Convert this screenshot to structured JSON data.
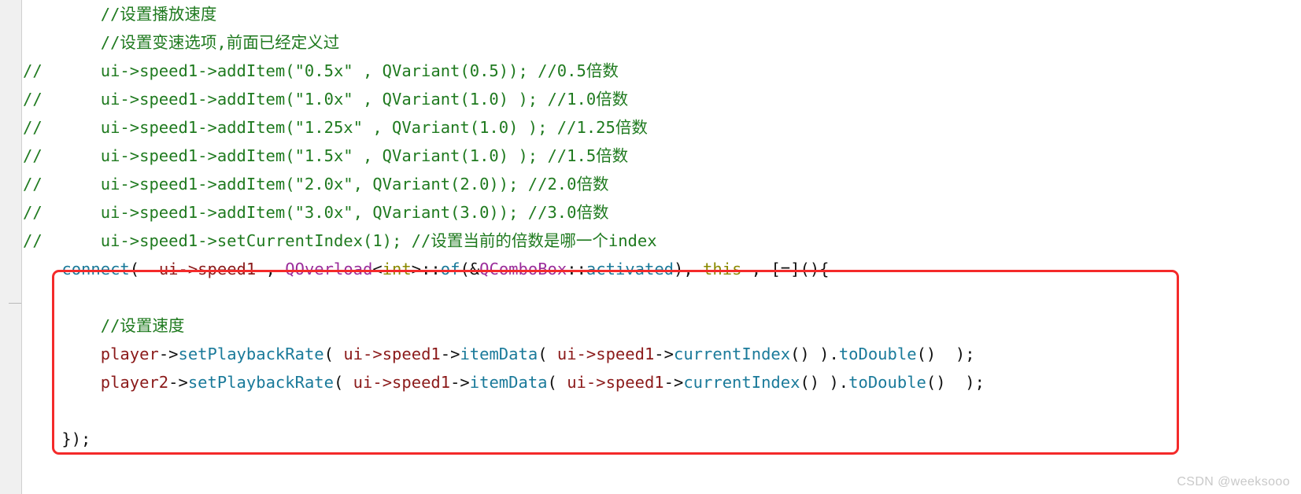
{
  "editor": {
    "gutter_present": true,
    "background_color": "#ffffff",
    "gutter_color": "#f0f0f0"
  },
  "colors": {
    "comment": "#1f7a1f",
    "function": "#1a7a9a",
    "variable": "#8b1a1a",
    "template_class": "#9b2d9b",
    "keyword": "#8a8a00",
    "punctuation": "#101010",
    "annotation_box": "#f42a2a",
    "watermark": "#c9c9c9"
  },
  "annotation": {
    "shape": "rounded-rectangle",
    "color": "#f42a2a",
    "encloses_lines": [
      9,
      10,
      11,
      12,
      13,
      14
    ]
  },
  "watermark": {
    "text": "CSDN @weeksooo"
  },
  "code_lines": [
    {
      "id": 1,
      "indent": 4,
      "tokens": [
        {
          "t": "//设置播放速度",
          "c": "cmt"
        }
      ]
    },
    {
      "id": 2,
      "indent": 4,
      "tokens": [
        {
          "t": "//设置变速选项,前面已经定义过",
          "c": "cmt"
        }
      ]
    },
    {
      "id": 3,
      "indent": 0,
      "tokens": [
        {
          "t": "//      ui->speed1->addItem(\"0.5x\" , QVariant(0.5)); //0.5倍数",
          "c": "cmt"
        }
      ]
    },
    {
      "id": 4,
      "indent": 0,
      "tokens": [
        {
          "t": "//      ui->speed1->addItem(\"1.0x\" , QVariant(1.0) ); //1.0倍数",
          "c": "cmt"
        }
      ]
    },
    {
      "id": 5,
      "indent": 0,
      "tokens": [
        {
          "t": "//      ui->speed1->addItem(\"1.25x\" , QVariant(1.0) ); //1.25倍数",
          "c": "cmt"
        }
      ]
    },
    {
      "id": 6,
      "indent": 0,
      "tokens": [
        {
          "t": "//      ui->speed1->addItem(\"1.5x\" , QVariant(1.0) ); //1.5倍数",
          "c": "cmt"
        }
      ]
    },
    {
      "id": 7,
      "indent": 0,
      "tokens": [
        {
          "t": "//      ui->speed1->addItem(\"2.0x\", QVariant(2.0)); //2.0倍数",
          "c": "cmt"
        }
      ]
    },
    {
      "id": 8,
      "indent": 0,
      "tokens": [
        {
          "t": "//      ui->speed1->addItem(\"3.0x\", QVariant(3.0)); //3.0倍数",
          "c": "cmt"
        }
      ]
    },
    {
      "id": 9,
      "indent": 0,
      "tokens": [
        {
          "t": "//      ui->speed1->setCurrentIndex(1); //设置当前的倍数是哪一个index",
          "c": "cmt"
        }
      ]
    },
    {
      "id": 10,
      "indent": 0,
      "tokens": [
        {
          "t": "    ",
          "c": "pun"
        },
        {
          "t": "connect",
          "c": "fn"
        },
        {
          "t": "(  ",
          "c": "pun"
        },
        {
          "t": "ui->speed1",
          "c": "var"
        },
        {
          "t": " , ",
          "c": "pun"
        },
        {
          "t": "QOverload",
          "c": "tmpl"
        },
        {
          "t": "<",
          "c": "pun"
        },
        {
          "t": "int",
          "c": "kw"
        },
        {
          "t": ">::",
          "c": "pun"
        },
        {
          "t": "of",
          "c": "fn"
        },
        {
          "t": "(&",
          "c": "pun"
        },
        {
          "t": "QComboBox",
          "c": "tmpl"
        },
        {
          "t": "::",
          "c": "pun"
        },
        {
          "t": "activated",
          "c": "fn"
        },
        {
          "t": "), ",
          "c": "pun"
        },
        {
          "t": "this",
          "c": "kw"
        },
        {
          "t": " , [=](){",
          "c": "pun"
        }
      ]
    },
    {
      "id": 11,
      "indent": 0,
      "tokens": []
    },
    {
      "id": 12,
      "indent": 0,
      "tokens": [
        {
          "t": "        ",
          "c": "pun"
        },
        {
          "t": "//设置速度",
          "c": "cmt"
        }
      ]
    },
    {
      "id": 13,
      "indent": 0,
      "tokens": [
        {
          "t": "        ",
          "c": "pun"
        },
        {
          "t": "player",
          "c": "var"
        },
        {
          "t": "->",
          "c": "pun"
        },
        {
          "t": "setPlaybackRate",
          "c": "fn"
        },
        {
          "t": "( ",
          "c": "pun"
        },
        {
          "t": "ui->speed1",
          "c": "var"
        },
        {
          "t": "->",
          "c": "pun"
        },
        {
          "t": "itemData",
          "c": "fn"
        },
        {
          "t": "( ",
          "c": "pun"
        },
        {
          "t": "ui->speed1",
          "c": "var"
        },
        {
          "t": "->",
          "c": "pun"
        },
        {
          "t": "currentIndex",
          "c": "fn"
        },
        {
          "t": "() ).",
          "c": "pun"
        },
        {
          "t": "toDouble",
          "c": "fn"
        },
        {
          "t": "()  );",
          "c": "pun"
        }
      ]
    },
    {
      "id": 14,
      "indent": 0,
      "tokens": [
        {
          "t": "        ",
          "c": "pun"
        },
        {
          "t": "player2",
          "c": "var"
        },
        {
          "t": "->",
          "c": "pun"
        },
        {
          "t": "setPlaybackRate",
          "c": "fn"
        },
        {
          "t": "( ",
          "c": "pun"
        },
        {
          "t": "ui->speed1",
          "c": "var"
        },
        {
          "t": "->",
          "c": "pun"
        },
        {
          "t": "itemData",
          "c": "fn"
        },
        {
          "t": "( ",
          "c": "pun"
        },
        {
          "t": "ui->speed1",
          "c": "var"
        },
        {
          "t": "->",
          "c": "pun"
        },
        {
          "t": "currentIndex",
          "c": "fn"
        },
        {
          "t": "() ).",
          "c": "pun"
        },
        {
          "t": "toDouble",
          "c": "fn"
        },
        {
          "t": "()  );",
          "c": "pun"
        }
      ]
    },
    {
      "id": 15,
      "indent": 0,
      "tokens": []
    },
    {
      "id": 16,
      "indent": 0,
      "tokens": [
        {
          "t": "    });",
          "c": "pun"
        }
      ]
    }
  ]
}
